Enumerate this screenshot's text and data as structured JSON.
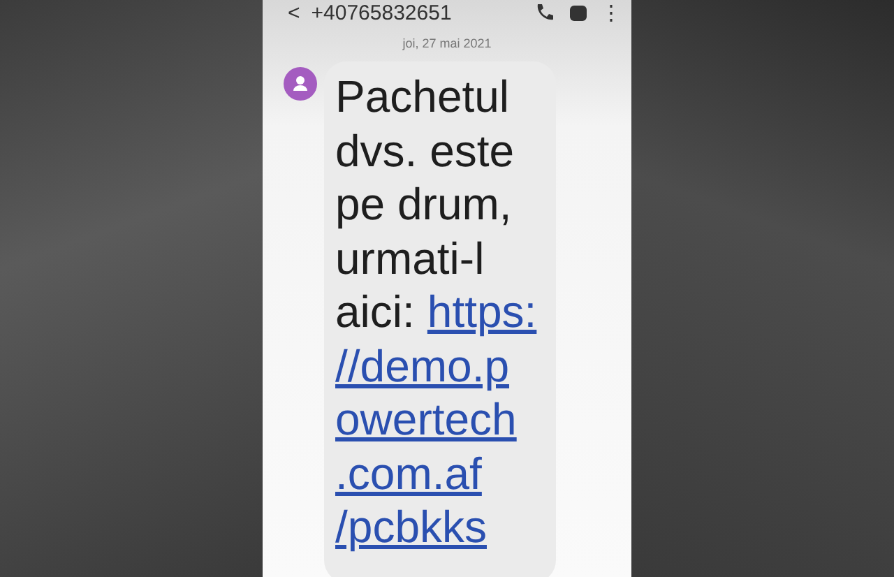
{
  "header": {
    "back": "<",
    "contact": "+40765832651",
    "menu": "⋮"
  },
  "date": "joi, 27 mai 2021",
  "message": {
    "lines": [
      {
        "text": "Pachetul"
      },
      {
        "text": "dvs. este"
      },
      {
        "text": "pe drum,"
      },
      {
        "text": "urmati-l"
      },
      {
        "text": "aici:",
        "link": "https:"
      },
      {
        "link": "//demo.p"
      },
      {
        "link": "owertech"
      },
      {
        "link": ".com.af"
      },
      {
        "link": "/pcbkks"
      }
    ]
  }
}
